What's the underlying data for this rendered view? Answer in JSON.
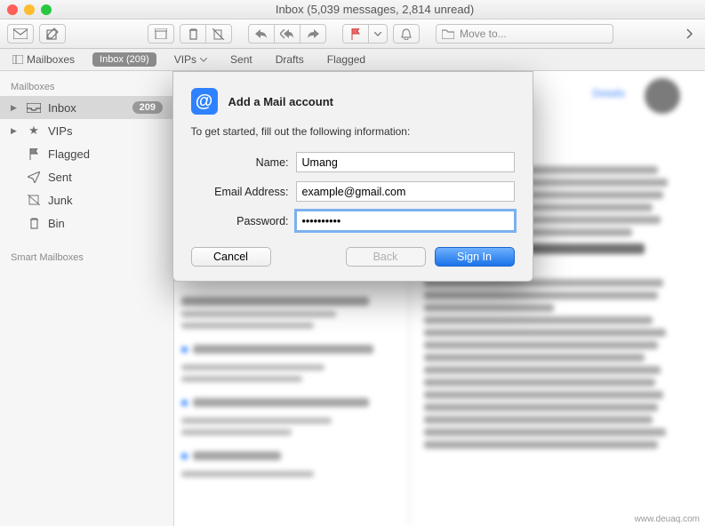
{
  "window": {
    "title": "Inbox (5,039 messages, 2,814 unread)"
  },
  "toolbar": {
    "move_placeholder": "Move to..."
  },
  "tabbar": {
    "mailboxes": "Mailboxes",
    "inbox_pill": "Inbox (209)",
    "vips": "VIPs",
    "sent": "Sent",
    "drafts": "Drafts",
    "flagged": "Flagged"
  },
  "sidebar": {
    "section1": "Mailboxes",
    "items": [
      {
        "label": "Inbox",
        "badge": "209"
      },
      {
        "label": "VIPs"
      },
      {
        "label": "Flagged"
      },
      {
        "label": "Sent"
      },
      {
        "label": "Junk"
      },
      {
        "label": "Bin"
      }
    ],
    "section2": "Smart Mailboxes"
  },
  "preview": {
    "details_link": "Details"
  },
  "dialog": {
    "title": "Add a Mail account",
    "subtitle": "To get started, fill out the following information:",
    "labels": {
      "name": "Name:",
      "email": "Email Address:",
      "password": "Password:"
    },
    "values": {
      "name": "Umang",
      "email": "example@gmail.com",
      "password": "••••••••••"
    },
    "buttons": {
      "cancel": "Cancel",
      "back": "Back",
      "signin": "Sign In"
    }
  },
  "watermark": "www.deuaq.com"
}
